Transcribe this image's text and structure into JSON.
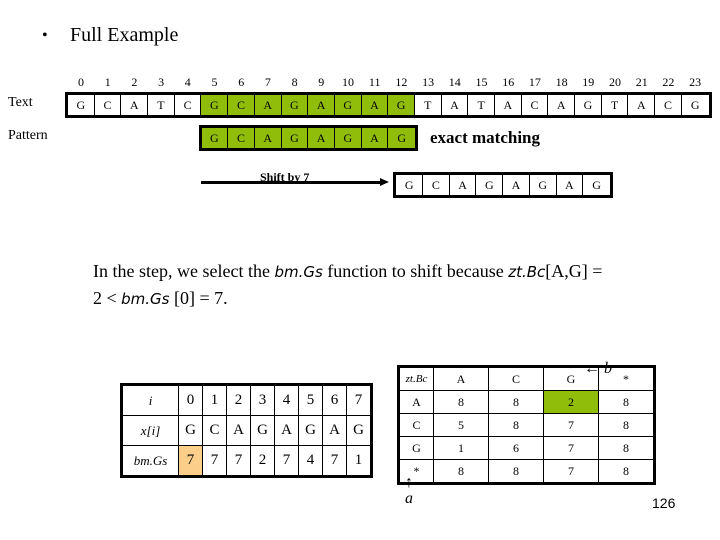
{
  "slide": {
    "bullet": "•",
    "title": "Full Example",
    "page_number": "126"
  },
  "alignment": {
    "indices": [
      "0",
      "1",
      "2",
      "3",
      "4",
      "5",
      "6",
      "7",
      "8",
      "9",
      "10",
      "11",
      "12",
      "13",
      "14",
      "15",
      "16",
      "17",
      "18",
      "19",
      "20",
      "21",
      "22",
      "23"
    ],
    "text_label": "Text",
    "pattern_label": "Pattern",
    "text": [
      "G",
      "C",
      "A",
      "T",
      "C",
      "G",
      "C",
      "A",
      "G",
      "A",
      "G",
      "A",
      "G",
      "T",
      "A",
      "T",
      "A",
      "C",
      "A",
      "G",
      "T",
      "A",
      "C",
      "G"
    ],
    "text_highlight_range": [
      5,
      12
    ],
    "pattern": [
      "G",
      "C",
      "A",
      "G",
      "A",
      "G",
      "A",
      "G"
    ],
    "pattern_start_index": 5,
    "exact_matching_label": "exact matching",
    "shift_label": "Shift by 7",
    "shifted_pattern": [
      "G",
      "C",
      "A",
      "G",
      "A",
      "G",
      "A",
      "G"
    ],
    "shifted_pattern_start_index": 12,
    "highlight_color": "#8fbd0a"
  },
  "explanation": {
    "line1_a": "In the step, we select the ",
    "line1_fn": "bm.Gs",
    "line1_b": " function to shift because ",
    "line1_fn2": "zt.Bc",
    "line1_c": "[A,G] =",
    "line2_a": "2 < ",
    "line2_fn": "bm.Gs",
    "line2_b": " [0] = 7."
  },
  "bmgs_table": {
    "header_i": "i",
    "header_x": "x[i]",
    "header_bmgs": "bm.Gs",
    "i": [
      "0",
      "1",
      "2",
      "3",
      "4",
      "5",
      "6",
      "7"
    ],
    "x": [
      "G",
      "C",
      "A",
      "G",
      "A",
      "G",
      "A",
      "G"
    ],
    "bmgs": [
      "7",
      "7",
      "7",
      "2",
      "7",
      "4",
      "7",
      "1"
    ],
    "highlight_index": 0,
    "highlight_color": "#fbcf8a"
  },
  "ztbc_table": {
    "corner": "zt.Bc",
    "columns": [
      "A",
      "C",
      "G",
      "*"
    ],
    "rows": [
      {
        "label": "A",
        "values": [
          "8",
          "8",
          "2",
          "8"
        ]
      },
      {
        "label": "C",
        "values": [
          "5",
          "8",
          "7",
          "8"
        ]
      },
      {
        "label": "G",
        "values": [
          "1",
          "6",
          "7",
          "8"
        ]
      },
      {
        "label": "*",
        "values": [
          "8",
          "8",
          "7",
          "8"
        ]
      }
    ],
    "highlight": {
      "row": 0,
      "col": 2
    },
    "highlight_color": "#8fbd0a",
    "b_label": "← b",
    "a_label": "a",
    "a_arrow": "↑"
  }
}
